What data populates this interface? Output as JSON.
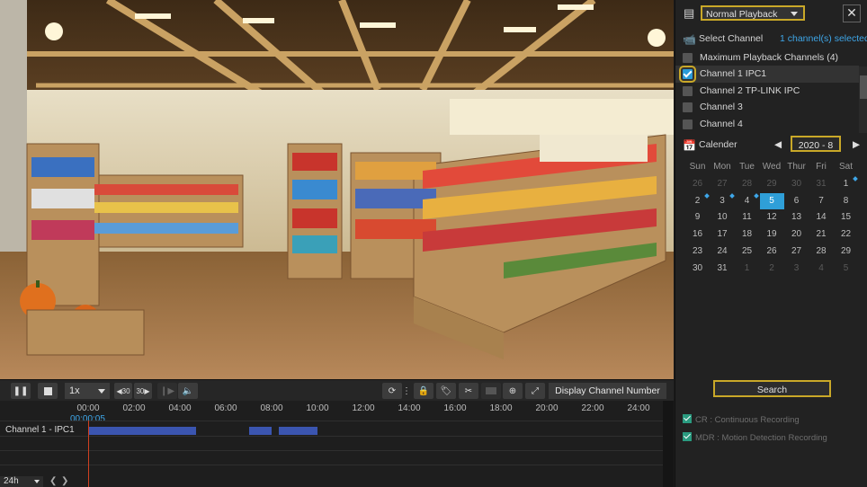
{
  "controls": {
    "speed": "1x",
    "skip_back": "30",
    "skip_fwd": "30",
    "display_channel_number": "Display Channel Number"
  },
  "timeline": {
    "ticks": [
      "00:00",
      "02:00",
      "04:00",
      "06:00",
      "08:00",
      "10:00",
      "12:00",
      "14:00",
      "16:00",
      "18:00",
      "20:00",
      "22:00",
      "24:00"
    ],
    "current_time": "00:00:05",
    "channel_label": "Channel 1 - IPC1",
    "range": "24h",
    "segments_hours": [
      [
        0,
        4.7
      ],
      [
        7,
        8
      ],
      [
        8.3,
        10
      ]
    ]
  },
  "panel": {
    "mode": "Normal Playback",
    "select_channel": "Select Channel",
    "selected_count": "1 channel(s) selected",
    "channels": [
      {
        "label": "Maximum Playback Channels (4)",
        "checked": false
      },
      {
        "label": "Channel 1 IPC1",
        "checked": true
      },
      {
        "label": "Channel 2 TP-LINK IPC",
        "checked": false
      },
      {
        "label": "Channel 3",
        "checked": false
      },
      {
        "label": "Channel 4",
        "checked": false
      }
    ],
    "calendar_label": "Calender",
    "year_month": "2020 - 8",
    "weekdays": [
      "Sun",
      "Mon",
      "Tue",
      "Wed",
      "Thur",
      "Fri",
      "Sat"
    ],
    "days": [
      [
        "26",
        "27",
        "28",
        "29",
        "30",
        "31",
        "1"
      ],
      [
        "2",
        "3",
        "4",
        "5",
        "6",
        "7",
        "8"
      ],
      [
        "9",
        "10",
        "11",
        "12",
        "13",
        "14",
        "15"
      ],
      [
        "16",
        "17",
        "18",
        "19",
        "20",
        "21",
        "22"
      ],
      [
        "23",
        "24",
        "25",
        "26",
        "27",
        "28",
        "29"
      ],
      [
        "30",
        "31",
        "1",
        "2",
        "3",
        "4",
        "5"
      ]
    ],
    "search": "Search",
    "legend_cr": "CR : Continuous Recording",
    "legend_mdr": "MDR : Motion Detection Recording",
    "accent": "#c9a828",
    "highlight": "#2f9fd8"
  }
}
